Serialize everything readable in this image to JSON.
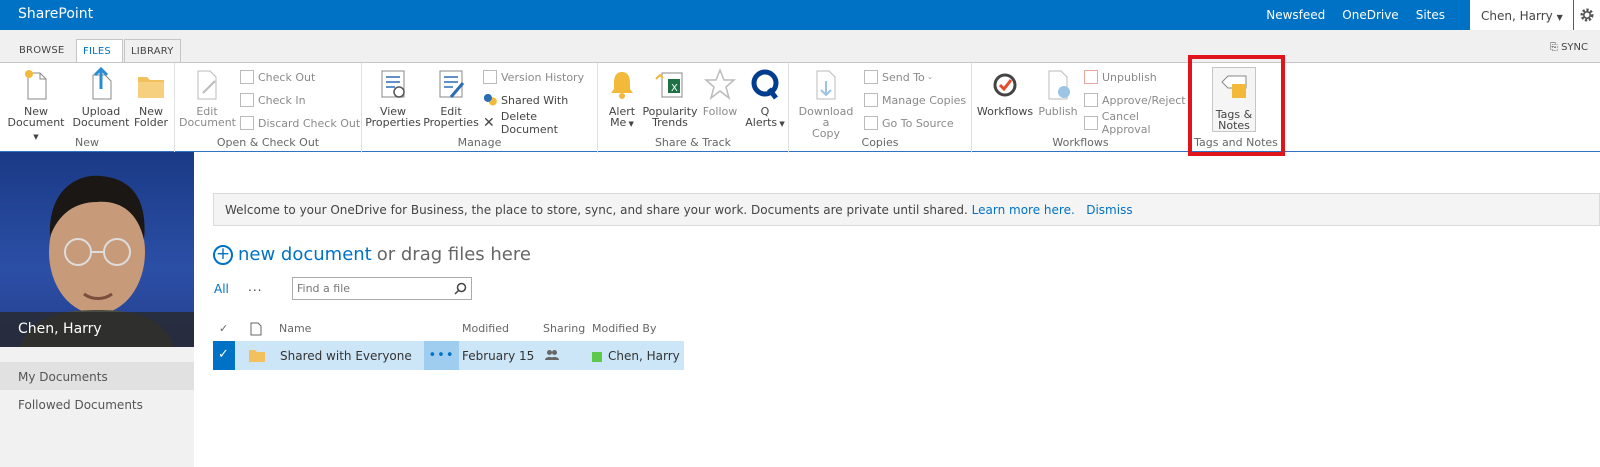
{
  "topbar": {
    "brand": "SharePoint",
    "nav": [
      "Newsfeed",
      "OneDrive",
      "Sites"
    ],
    "user": "Chen, Harry",
    "settings_icon": "gear-icon",
    "accent": "#0072c6"
  },
  "tabs": {
    "browse": "BROWSE",
    "files": "FILES",
    "library": "LIBRARY",
    "sync": "SYNC"
  },
  "ribbon": {
    "new": {
      "label": "New",
      "new_document": "New Document",
      "new_document_l1": "New",
      "new_document_l2": "Document",
      "upload_l1": "Upload",
      "upload_l2": "Document",
      "folder_l1": "New",
      "folder_l2": "Folder"
    },
    "open_checkout": {
      "label": "Open & Check Out",
      "edit_l1": "Edit",
      "edit_l2": "Document",
      "check_out": "Check Out",
      "check_in": "Check In",
      "discard": "Discard Check Out"
    },
    "manage": {
      "label": "Manage",
      "view_l1": "View",
      "view_l2": "Properties",
      "editp_l1": "Edit",
      "editp_l2": "Properties",
      "version_history": "Version History",
      "shared_with": "Shared With",
      "delete_document": "Delete Document"
    },
    "share_track": {
      "label": "Share & Track",
      "alert_l1": "Alert",
      "alert_l2": "Me",
      "pop_l1": "Popularity",
      "pop_l2": "Trends",
      "follow": "Follow",
      "q_l1": "Q",
      "q_l2": "Alerts"
    },
    "copies": {
      "label": "Copies",
      "download_l1": "Download a",
      "download_l2": "Copy",
      "send_to": "Send To",
      "manage_copies": "Manage Copies",
      "go_to_source": "Go To Source"
    },
    "workflows": {
      "label": "Workflows",
      "workflows": "Workflows",
      "publish": "Publish",
      "unpublish": "Unpublish",
      "approve_reject": "Approve/Reject",
      "cancel_approval": "Cancel Approval"
    },
    "tags_notes": {
      "label": "Tags and Notes",
      "btn_l1": "Tags &",
      "btn_l2": "Notes"
    }
  },
  "sidebar": {
    "user_name": "Chen, Harry",
    "items": [
      "My Documents",
      "Followed Documents"
    ]
  },
  "banner": {
    "text": "Welcome to your OneDrive for Business, the place to store, sync, and share your work. Documents are private until shared.",
    "learn_more": "Learn more here.",
    "dismiss": "Dismiss"
  },
  "main": {
    "new_document_link": "new document",
    "drag_text": "or drag files here",
    "view_all": "All",
    "more": "...",
    "search_placeholder": "Find a file"
  },
  "table": {
    "headers": {
      "name": "Name",
      "modified": "Modified",
      "sharing": "Sharing",
      "modified_by": "Modified By"
    },
    "rows": [
      {
        "name": "Shared with Everyone",
        "modified": "February 15",
        "modified_by": "Chen, Harry"
      }
    ]
  }
}
